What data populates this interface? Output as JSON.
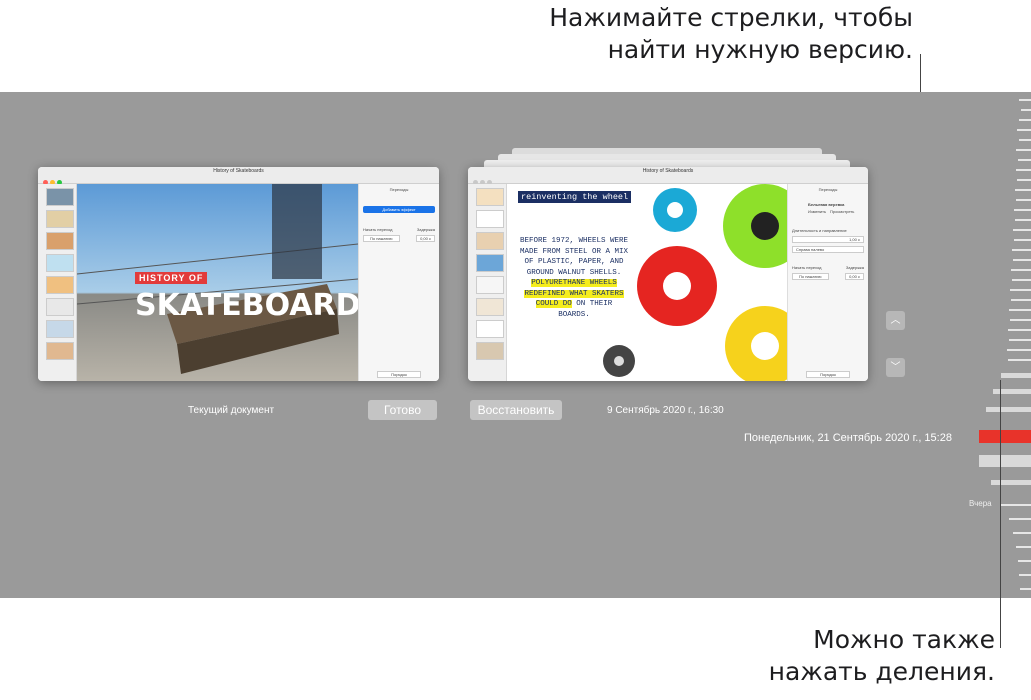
{
  "callouts": {
    "top_line1": "Нажимайте стрелки, чтобы",
    "top_line2": "найти нужную версию.",
    "bottom_line1": "Можно также",
    "bottom_line2": "нажать деления."
  },
  "current_window": {
    "title": "History of Skateboards",
    "slide_text_1": "HISTORY OF",
    "slide_text_2": "SKATEBOARDS",
    "inspector_header": "Переходы",
    "inspector_add": "Добавить эффект",
    "inspector_start": "Начать переход",
    "inspector_delay": "Задержка",
    "inspector_select": "По нажатию",
    "inspector_delay_value": "0,00 с",
    "inspector_footer": "Порядок"
  },
  "version_window": {
    "title": "History of Skateboards",
    "heading": "reinventing the wheel",
    "body_plain": "BEFORE 1972, WHEELS WERE MADE FROM STEEL OR A MIX OF PLASTIC, PAPER, AND GROUND WALNUT SHELLS.",
    "body_highlight": "POLYURETHANE WHEELS REDEFINED WHAT SKATERS COULD DO",
    "body_tail": "ON THEIR BOARDS.",
    "inspector_header": "Переходы",
    "inspector_effect": "Бельевая веревка",
    "inspector_fx1": "Изменить",
    "inspector_fx2": "Просмотреть",
    "inspector_duration": "Длительность и направление",
    "inspector_duration_value": "1,00 с",
    "inspector_direction": "Справа налево",
    "inspector_start": "Начать переход",
    "inspector_delay": "Задержка",
    "inspector_select": "По нажатию",
    "inspector_delay_value": "0,00 с",
    "inspector_footer": "Порядок"
  },
  "controls": {
    "current_label": "Текущий документ",
    "done_button": "Готово",
    "restore_button": "Восстановить",
    "version_date": "9 Сентябрь 2020 г., 16:30",
    "timeline_date": "Понедельник, 21 Сентябрь 2020 г., 15:28",
    "yesterday": "Вчера",
    "up_icon": "chevron-up-icon",
    "down_icon": "chevron-down-icon"
  },
  "colors": {
    "stage": "#9a9a9a",
    "timeline_active": "#e8332a",
    "highlight": "#f5ed1d",
    "accent_blue": "#1a73e8"
  }
}
